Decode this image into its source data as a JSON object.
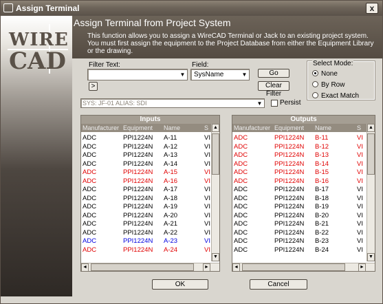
{
  "window": {
    "title": "Assign Terminal",
    "close_glyph": "x"
  },
  "logo": {
    "line1": "WIRE",
    "line2": "CAD"
  },
  "header": {
    "title": "Assign Terminal from Project System",
    "description": "This function allows you to assign a WireCAD Terminal or Jack to an existing project system. You must first assign the equipment to the Project Database from either the Equipment Library or the drawing."
  },
  "filter": {
    "filter_text_label": "Filter Text:",
    "filter_text_value": "",
    "field_label": "Field:",
    "field_value": "SysName",
    "expand_label": ">",
    "go_label": "Go",
    "clear_label": "Clear Filter"
  },
  "select_mode": {
    "label": "Select Mode:",
    "options": [
      "None",
      "By Row",
      "Exact Match"
    ],
    "selected": "None"
  },
  "system_combo": {
    "value": "SYS: JF-01     ALIAS: SDI"
  },
  "persist": {
    "label": "Persist",
    "checked": false
  },
  "inputs": {
    "title": "Inputs",
    "columns": [
      "Manufacturer",
      "Equipment",
      "Name",
      "S"
    ],
    "rows": [
      {
        "mfr": "ADC",
        "equip": "PPI1224N",
        "name": "A-11",
        "s": "VI",
        "color": "#000000"
      },
      {
        "mfr": "ADC",
        "equip": "PPI1224N",
        "name": "A-12",
        "s": "VI",
        "color": "#000000"
      },
      {
        "mfr": "ADC",
        "equip": "PPI1224N",
        "name": "A-13",
        "s": "VI",
        "color": "#000000"
      },
      {
        "mfr": "ADC",
        "equip": "PPI1224N",
        "name": "A-14",
        "s": "VI",
        "color": "#000000"
      },
      {
        "mfr": "ADC",
        "equip": "PPI1224N",
        "name": "A-15",
        "s": "VI",
        "color": "#e00000"
      },
      {
        "mfr": "ADC",
        "equip": "PPI1224N",
        "name": "A-16",
        "s": "VI",
        "color": "#e00000"
      },
      {
        "mfr": "ADC",
        "equip": "PPI1224N",
        "name": "A-17",
        "s": "VI",
        "color": "#000000"
      },
      {
        "mfr": "ADC",
        "equip": "PPI1224N",
        "name": "A-18",
        "s": "VI",
        "color": "#000000"
      },
      {
        "mfr": "ADC",
        "equip": "PPI1224N",
        "name": "A-19",
        "s": "VI",
        "color": "#000000"
      },
      {
        "mfr": "ADC",
        "equip": "PPI1224N",
        "name": "A-20",
        "s": "VI",
        "color": "#000000"
      },
      {
        "mfr": "ADC",
        "equip": "PPI1224N",
        "name": "A-21",
        "s": "VI",
        "color": "#000000"
      },
      {
        "mfr": "ADC",
        "equip": "PPI1224N",
        "name": "A-22",
        "s": "VI",
        "color": "#000000"
      },
      {
        "mfr": "ADC",
        "equip": "PPI1224N",
        "name": "A-23",
        "s": "VI",
        "color": "#0000e0"
      },
      {
        "mfr": "ADC",
        "equip": "PPI1224N",
        "name": "A-24",
        "s": "VI",
        "color": "#e00000"
      }
    ]
  },
  "outputs": {
    "title": "Outputs",
    "columns": [
      "Manufacturer",
      "Equipment",
      "Name",
      "S"
    ],
    "rows": [
      {
        "mfr": "ADC",
        "equip": "PPI1224N",
        "name": "B-11",
        "s": "VI",
        "color": "#e00000"
      },
      {
        "mfr": "ADC",
        "equip": "PPI1224N",
        "name": "B-12",
        "s": "VI",
        "color": "#e00000"
      },
      {
        "mfr": "ADC",
        "equip": "PPI1224N",
        "name": "B-13",
        "s": "VI",
        "color": "#e00000"
      },
      {
        "mfr": "ADC",
        "equip": "PPI1224N",
        "name": "B-14",
        "s": "VI",
        "color": "#e00000"
      },
      {
        "mfr": "ADC",
        "equip": "PPI1224N",
        "name": "B-15",
        "s": "VI",
        "color": "#e00000"
      },
      {
        "mfr": "ADC",
        "equip": "PPI1224N",
        "name": "B-16",
        "s": "VI",
        "color": "#e00000"
      },
      {
        "mfr": "ADC",
        "equip": "PPI1224N",
        "name": "B-17",
        "s": "VI",
        "color": "#000000"
      },
      {
        "mfr": "ADC",
        "equip": "PPI1224N",
        "name": "B-18",
        "s": "VI",
        "color": "#000000"
      },
      {
        "mfr": "ADC",
        "equip": "PPI1224N",
        "name": "B-19",
        "s": "VI",
        "color": "#000000"
      },
      {
        "mfr": "ADC",
        "equip": "PPI1224N",
        "name": "B-20",
        "s": "VI",
        "color": "#000000"
      },
      {
        "mfr": "ADC",
        "equip": "PPI1224N",
        "name": "B-21",
        "s": "VI",
        "color": "#000000"
      },
      {
        "mfr": "ADC",
        "equip": "PPI1224N",
        "name": "B-22",
        "s": "VI",
        "color": "#000000"
      },
      {
        "mfr": "ADC",
        "equip": "PPI1224N",
        "name": "B-23",
        "s": "VI",
        "color": "#000000"
      },
      {
        "mfr": "ADC",
        "equip": "PPI1224N",
        "name": "B-24",
        "s": "VI",
        "color": "#000000"
      }
    ]
  },
  "footer": {
    "ok_label": "OK",
    "cancel_label": "Cancel"
  }
}
